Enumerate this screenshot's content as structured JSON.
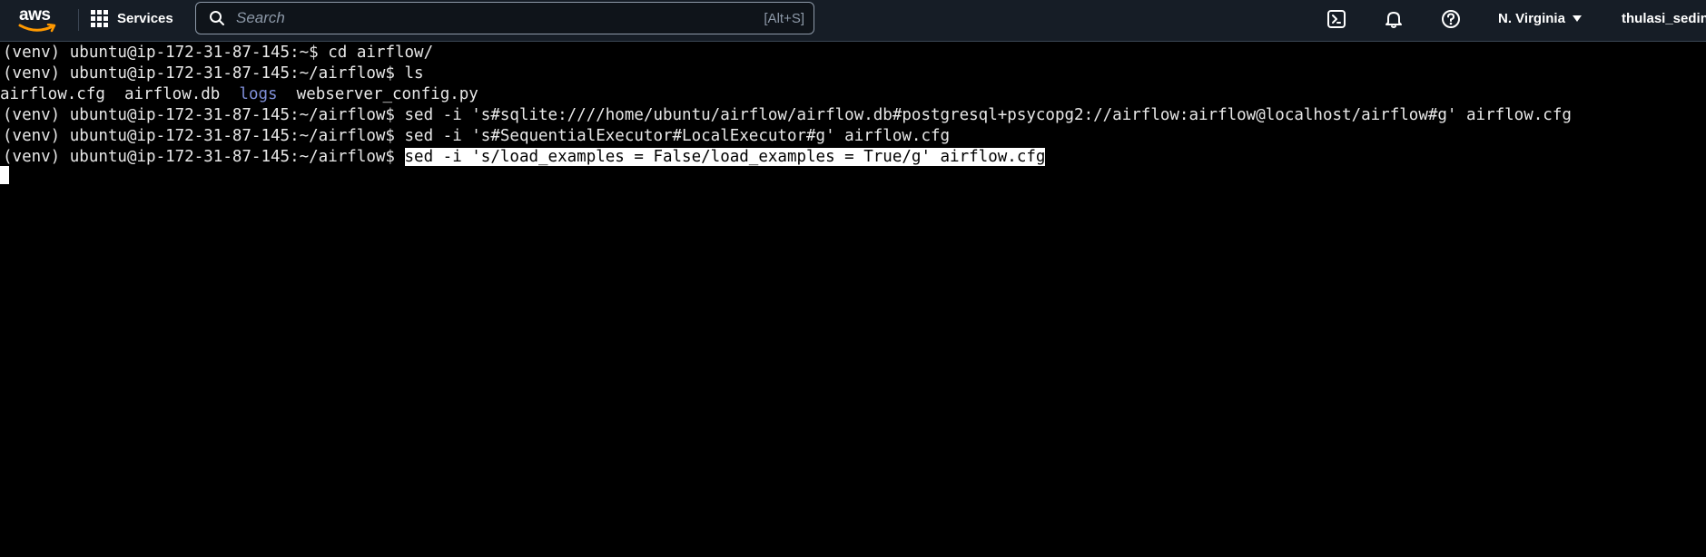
{
  "topbar": {
    "logo_text": "aws",
    "services_label": "Services",
    "search_placeholder": "Search",
    "search_shortcut": "[Alt+S]",
    "region_label": "N. Virginia",
    "user_label": "thulasi_sedin",
    "icons": [
      "aws-smile-logo",
      "grid-icon",
      "search-icon",
      "cloudshell-icon",
      "bell-icon",
      "help-icon",
      "caret-down-icon"
    ]
  },
  "terminal": {
    "lines": [
      {
        "prompt": "(venv) ubuntu@ip-172-31-87-145:~$ ",
        "command": "cd airflow/"
      },
      {
        "prompt": "(venv) ubuntu@ip-172-31-87-145:~/airflow$ ",
        "command": "ls"
      },
      {
        "ls_output": [
          "airflow.cfg",
          "airflow.db",
          "logs",
          "webserver_config.py"
        ]
      },
      {
        "prompt": "(venv) ubuntu@ip-172-31-87-145:~/airflow$ ",
        "command": "sed -i 's#sqlite:////home/ubuntu/airflow/airflow.db#postgresql+psycopg2://airflow:airflow@localhost/airflow#g' airflow.cfg"
      },
      {
        "prompt": "(venv) ubuntu@ip-172-31-87-145:~/airflow$ ",
        "command": "sed -i 's#SequentialExecutor#LocalExecutor#g' airflow.cfg"
      },
      {
        "prompt": "(venv) ubuntu@ip-172-31-87-145:~/airflow$ ",
        "command": "sed -i 's/load_examples = False/load_examples = True/g' airflow.cfg",
        "selected": true
      }
    ],
    "ls_separator": "  ",
    "colors": {
      "background": "#000000",
      "text": "#e8e8e8",
      "directory": "#7f8fd8",
      "selection_bg": "#ffffff",
      "selection_fg": "#000000"
    }
  }
}
